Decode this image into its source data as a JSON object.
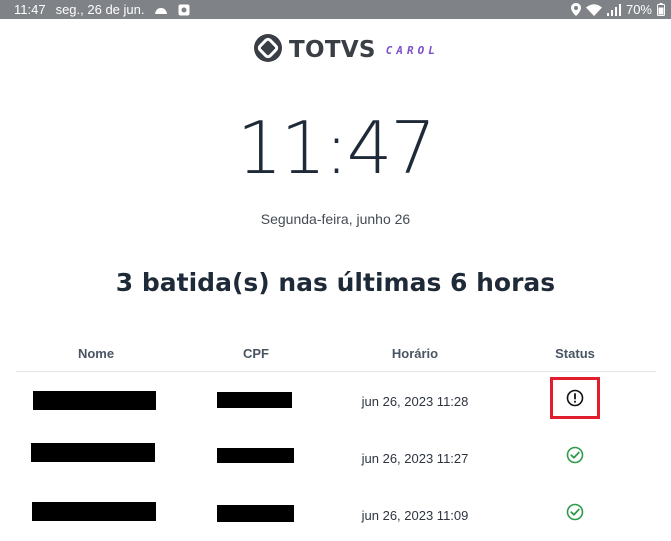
{
  "statusbar": {
    "time": "11:47",
    "date": "seg., 26 de jun.",
    "battery": "70%"
  },
  "brand": {
    "name": "TOTVS",
    "product": "CAROL"
  },
  "clock": {
    "time": "11:47",
    "date": "Segunda-feira, junho 26"
  },
  "summary": {
    "heading": "3 batida(s) nas últimas 6 horas"
  },
  "table": {
    "headers": [
      "Nome",
      "CPF",
      "Horário",
      "Status"
    ],
    "rows": [
      {
        "horario": "jun 26, 2023 11:28",
        "status": "warning"
      },
      {
        "horario": "jun 26, 2023 11:27",
        "status": "ok"
      },
      {
        "horario": "jun 26, 2023 11:09",
        "status": "ok"
      }
    ]
  },
  "colors": {
    "accent_purple": "#7a4fc9",
    "status_ok": "#2e9a4a",
    "highlight_red": "#e01e2e",
    "text_dark": "#1f2a38"
  }
}
